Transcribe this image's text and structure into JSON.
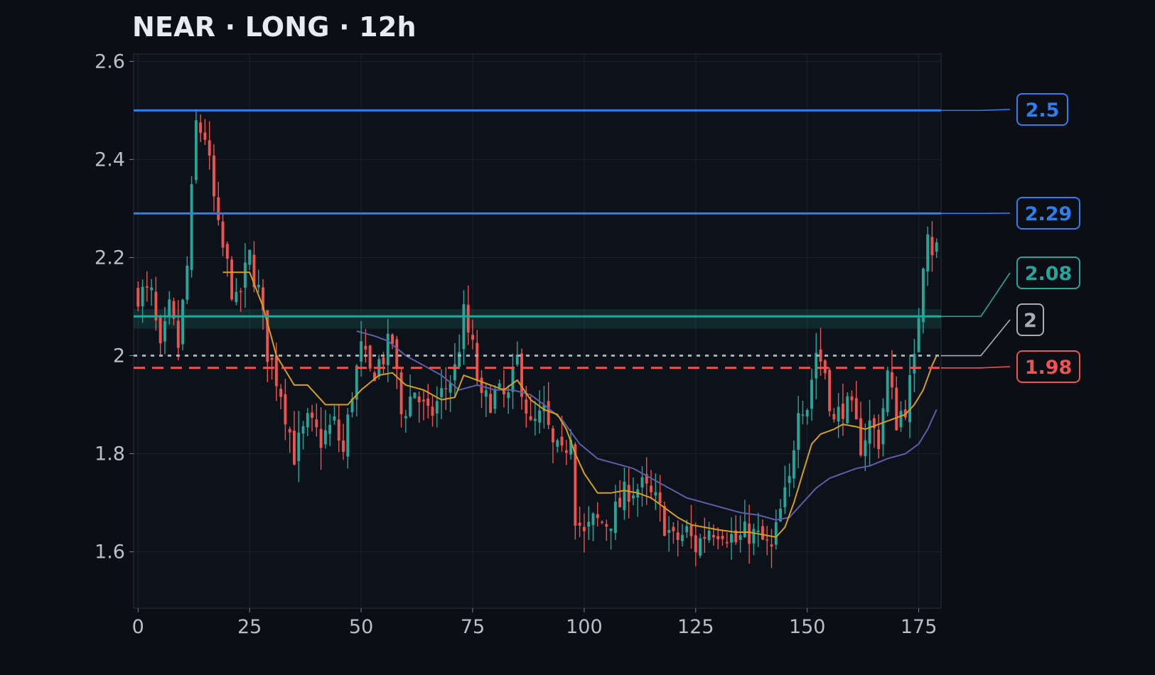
{
  "title": "NEAR · LONG · 12h",
  "chart_data": {
    "type": "candlestick",
    "title": "NEAR · LONG · 12h",
    "xlabel": "",
    "ylabel": "",
    "xlim": [
      -1,
      180
    ],
    "ylim": [
      1.485,
      2.615
    ],
    "x_ticks": [
      0,
      25,
      50,
      75,
      100,
      125,
      150,
      175
    ],
    "y_ticks": [
      1.6,
      1.8,
      2.0,
      2.2,
      2.4,
      2.6
    ],
    "y_tick_labels": [
      "1.6",
      "1.8",
      "2",
      "2.2",
      "2.4",
      "2.6"
    ],
    "grid": true,
    "colors": {
      "up": "#26a69a",
      "down": "#ef5350",
      "ma_fast": "#d4a017",
      "ma_slow": "#5c5fa8",
      "take_profit": "#2f7ef0",
      "entry": "#26a69a",
      "current": "#a8adb5",
      "stop_loss": "#ef5350"
    },
    "entry_zone": [
      2.055,
      2.095
    ],
    "levels": [
      {
        "label": "2.5",
        "value": 2.5,
        "role": "take-profit",
        "color": "#2f7ef0",
        "style": "solid"
      },
      {
        "label": "2.29",
        "value": 2.29,
        "role": "take-profit",
        "color": "#2f7ef0",
        "style": "solid"
      },
      {
        "label": "2.08",
        "value": 2.08,
        "role": "entry",
        "color": "#26a69a",
        "style": "solid"
      },
      {
        "label": "2",
        "value": 2.0,
        "role": "current",
        "color": "#a8adb5",
        "style": "dotted"
      },
      {
        "label": "1.98",
        "value": 1.975,
        "role": "stop-loss",
        "color": "#ef5350",
        "style": "dashed"
      }
    ],
    "candle_keypoints": [
      [
        0,
        2.13
      ],
      [
        3,
        2.12
      ],
      [
        5,
        2.0
      ],
      [
        7,
        2.09
      ],
      [
        9,
        2.02
      ],
      [
        11,
        2.18
      ],
      [
        13,
        2.47
      ],
      [
        15,
        2.45
      ],
      [
        18,
        2.25
      ],
      [
        20,
        2.18
      ],
      [
        22,
        2.1
      ],
      [
        25,
        2.2
      ],
      [
        27,
        2.13
      ],
      [
        29,
        2.01
      ],
      [
        32,
        1.93
      ],
      [
        35,
        1.8
      ],
      [
        38,
        1.86
      ],
      [
        41,
        1.83
      ],
      [
        44,
        1.86
      ],
      [
        46,
        1.8
      ],
      [
        48,
        1.93
      ],
      [
        50,
        2.01
      ],
      [
        52,
        1.96
      ],
      [
        55,
        2.0
      ],
      [
        57,
        2.03
      ],
      [
        59,
        1.88
      ],
      [
        62,
        1.93
      ],
      [
        65,
        1.87
      ],
      [
        68,
        1.92
      ],
      [
        71,
        1.97
      ],
      [
        73,
        2.08
      ],
      [
        75,
        2.01
      ],
      [
        77,
        1.9
      ],
      [
        80,
        1.92
      ],
      [
        83,
        1.91
      ],
      [
        85,
        1.99
      ],
      [
        88,
        1.85
      ],
      [
        91,
        1.88
      ],
      [
        93,
        1.81
      ],
      [
        95,
        1.79
      ],
      [
        97,
        1.85
      ],
      [
        98,
        1.68
      ],
      [
        100,
        1.63
      ],
      [
        102,
        1.66
      ],
      [
        105,
        1.66
      ],
      [
        107,
        1.68
      ],
      [
        110,
        1.73
      ],
      [
        113,
        1.73
      ],
      [
        116,
        1.7
      ],
      [
        118,
        1.66
      ],
      [
        120,
        1.62
      ],
      [
        123,
        1.64
      ],
      [
        125,
        1.61
      ],
      [
        128,
        1.65
      ],
      [
        131,
        1.65
      ],
      [
        134,
        1.62
      ],
      [
        137,
        1.64
      ],
      [
        140,
        1.62
      ],
      [
        142,
        1.6
      ],
      [
        144,
        1.68
      ],
      [
        146,
        1.74
      ],
      [
        148,
        1.91
      ],
      [
        150,
        1.9
      ],
      [
        152,
        2.01
      ],
      [
        154,
        1.97
      ],
      [
        156,
        1.86
      ],
      [
        158,
        1.9
      ],
      [
        160,
        1.88
      ],
      [
        162,
        1.82
      ],
      [
        164,
        1.86
      ],
      [
        166,
        1.83
      ],
      [
        168,
        1.96
      ],
      [
        170,
        1.87
      ],
      [
        172,
        1.9
      ],
      [
        174,
        1.98
      ],
      [
        176,
        2.2
      ],
      [
        177,
        2.27
      ],
      [
        178,
        2.22
      ],
      [
        179,
        2.22
      ]
    ],
    "ma_fast_keypoints": [
      [
        19,
        2.17
      ],
      [
        22,
        2.17
      ],
      [
        25,
        2.17
      ],
      [
        28,
        2.1
      ],
      [
        31,
        2.0
      ],
      [
        35,
        1.94
      ],
      [
        38,
        1.94
      ],
      [
        42,
        1.9
      ],
      [
        45,
        1.9
      ],
      [
        47,
        1.9
      ],
      [
        50,
        1.93
      ],
      [
        54,
        1.96
      ],
      [
        57,
        1.965
      ],
      [
        60,
        1.94
      ],
      [
        64,
        1.93
      ],
      [
        68,
        1.91
      ],
      [
        71,
        1.915
      ],
      [
        73,
        1.96
      ],
      [
        76,
        1.95
      ],
      [
        79,
        1.94
      ],
      [
        82,
        1.93
      ],
      [
        85,
        1.95
      ],
      [
        88,
        1.91
      ],
      [
        91,
        1.89
      ],
      [
        94,
        1.88
      ],
      [
        96,
        1.85
      ],
      [
        98,
        1.8
      ],
      [
        100,
        1.76
      ],
      [
        103,
        1.72
      ],
      [
        106,
        1.72
      ],
      [
        109,
        1.725
      ],
      [
        112,
        1.72
      ],
      [
        115,
        1.71
      ],
      [
        118,
        1.69
      ],
      [
        121,
        1.67
      ],
      [
        124,
        1.655
      ],
      [
        127,
        1.65
      ],
      [
        130,
        1.645
      ],
      [
        134,
        1.64
      ],
      [
        137,
        1.64
      ],
      [
        140,
        1.635
      ],
      [
        143,
        1.63
      ],
      [
        145,
        1.65
      ],
      [
        147,
        1.7
      ],
      [
        149,
        1.76
      ],
      [
        151,
        1.82
      ],
      [
        153,
        1.84
      ],
      [
        156,
        1.85
      ],
      [
        158,
        1.86
      ],
      [
        161,
        1.855
      ],
      [
        163,
        1.85
      ],
      [
        166,
        1.86
      ],
      [
        169,
        1.87
      ],
      [
        172,
        1.88
      ],
      [
        174,
        1.9
      ],
      [
        176,
        1.93
      ],
      [
        178,
        1.98
      ],
      [
        179,
        2.0
      ]
    ],
    "ma_slow_keypoints": [
      [
        49,
        2.05
      ],
      [
        53,
        2.04
      ],
      [
        56,
        2.03
      ],
      [
        60,
        2.0
      ],
      [
        64,
        1.98
      ],
      [
        68,
        1.96
      ],
      [
        72,
        1.93
      ],
      [
        76,
        1.94
      ],
      [
        80,
        1.93
      ],
      [
        84,
        1.93
      ],
      [
        88,
        1.92
      ],
      [
        91,
        1.9
      ],
      [
        95,
        1.87
      ],
      [
        99,
        1.82
      ],
      [
        103,
        1.79
      ],
      [
        107,
        1.78
      ],
      [
        111,
        1.77
      ],
      [
        115,
        1.75
      ],
      [
        119,
        1.73
      ],
      [
        123,
        1.71
      ],
      [
        127,
        1.7
      ],
      [
        131,
        1.69
      ],
      [
        135,
        1.68
      ],
      [
        139,
        1.675
      ],
      [
        143,
        1.665
      ],
      [
        146,
        1.67
      ],
      [
        149,
        1.7
      ],
      [
        152,
        1.73
      ],
      [
        155,
        1.75
      ],
      [
        158,
        1.76
      ],
      [
        161,
        1.77
      ],
      [
        164,
        1.775
      ],
      [
        168,
        1.79
      ],
      [
        172,
        1.8
      ],
      [
        175,
        1.82
      ],
      [
        177,
        1.85
      ],
      [
        179,
        1.89
      ]
    ]
  }
}
